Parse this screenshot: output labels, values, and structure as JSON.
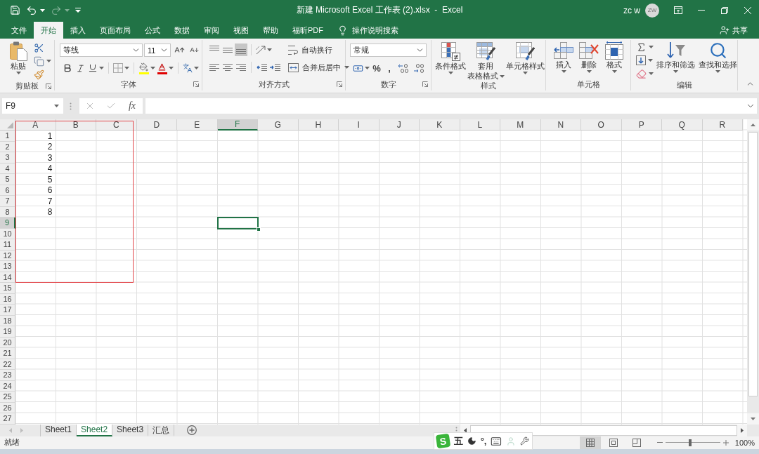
{
  "window": {
    "title": "新建 Microsoft Excel 工作表 (2).xlsx  -  Excel",
    "user": "zc w",
    "avatar_initials": "ZW"
  },
  "quick_access": {
    "save": {
      "disabled": false
    },
    "undo": {
      "disabled": false
    },
    "redo": {
      "disabled": true
    }
  },
  "ribbon_tabs": [
    {
      "label": "文件",
      "selected": false
    },
    {
      "label": "开始",
      "selected": true
    },
    {
      "label": "插入",
      "selected": false
    },
    {
      "label": "页面布局",
      "selected": false
    },
    {
      "label": "公式",
      "selected": false
    },
    {
      "label": "数据",
      "selected": false
    },
    {
      "label": "审阅",
      "selected": false
    },
    {
      "label": "视图",
      "selected": false
    },
    {
      "label": "帮助",
      "selected": false
    },
    {
      "label": "福昕PDF",
      "selected": false
    }
  ],
  "tell_me": {
    "placeholder": "操作说明搜索"
  },
  "share": {
    "label": "共享"
  },
  "ribbon": {
    "clipboard": {
      "label": "剪贴板",
      "paste": "粘贴"
    },
    "font": {
      "label": "字体",
      "font_name": "等线",
      "font_size": "11"
    },
    "alignment": {
      "label": "对齐方式",
      "vertical_align": [
        {
          "selected": false
        },
        {
          "selected": false
        },
        {
          "selected": true
        }
      ],
      "wrap_text": "自动换行",
      "merge_center": "合并后居中"
    },
    "number": {
      "label": "数字",
      "format": "常规",
      "percent": "%",
      "comma": ","
    },
    "styles": {
      "label": "样式",
      "buttons": [
        {
          "lines": [
            "条件格式"
          ]
        },
        {
          "lines": [
            "套用",
            "表格格式"
          ]
        },
        {
          "lines": [
            "单元格样式"
          ]
        }
      ]
    },
    "cells": {
      "label": "单元格",
      "buttons": [
        "插入",
        "删除",
        "格式"
      ]
    },
    "editing": {
      "label": "编辑",
      "buttons": [
        "排序和筛选",
        "查找和选择"
      ]
    }
  },
  "formula_bar": {
    "name_box": "F9",
    "function_label": "fx"
  },
  "sheet": {
    "columns": [
      {
        "label": "A",
        "selected": false
      },
      {
        "label": "B",
        "selected": false
      },
      {
        "label": "C",
        "selected": false
      },
      {
        "label": "D",
        "selected": false
      },
      {
        "label": "E",
        "selected": false
      },
      {
        "label": "F",
        "selected": true
      },
      {
        "label": "G",
        "selected": false
      },
      {
        "label": "H",
        "selected": false
      },
      {
        "label": "I",
        "selected": false
      },
      {
        "label": "J",
        "selected": false
      },
      {
        "label": "K",
        "selected": false
      },
      {
        "label": "L",
        "selected": false
      },
      {
        "label": "M",
        "selected": false
      },
      {
        "label": "N",
        "selected": false
      },
      {
        "label": "O",
        "selected": false
      },
      {
        "label": "P",
        "selected": false
      },
      {
        "label": "Q",
        "selected": false
      },
      {
        "label": "R",
        "selected": false
      }
    ],
    "rows": [
      {
        "label": "1",
        "selected": false,
        "values": [
          "1"
        ]
      },
      {
        "label": "2",
        "selected": false,
        "values": [
          "2"
        ]
      },
      {
        "label": "3",
        "selected": false,
        "values": [
          "3"
        ]
      },
      {
        "label": "4",
        "selected": false,
        "values": [
          "4"
        ]
      },
      {
        "label": "5",
        "selected": false,
        "values": [
          "5"
        ]
      },
      {
        "label": "6",
        "selected": false,
        "values": [
          "6"
        ]
      },
      {
        "label": "7",
        "selected": false,
        "values": [
          "7"
        ]
      },
      {
        "label": "8",
        "selected": false,
        "values": [
          "8"
        ]
      },
      {
        "label": "9",
        "selected": true
      },
      {
        "label": "10",
        "selected": false
      },
      {
        "label": "11",
        "selected": false
      },
      {
        "label": "12",
        "selected": false
      },
      {
        "label": "13",
        "selected": false
      },
      {
        "label": "14",
        "selected": false
      },
      {
        "label": "15",
        "selected": false
      },
      {
        "label": "16",
        "selected": false
      },
      {
        "label": "17",
        "selected": false
      },
      {
        "label": "18",
        "selected": false
      },
      {
        "label": "19",
        "selected": false
      },
      {
        "label": "20",
        "selected": false
      },
      {
        "label": "21",
        "selected": false
      },
      {
        "label": "22",
        "selected": false
      },
      {
        "label": "23",
        "selected": false
      },
      {
        "label": "24",
        "selected": false
      },
      {
        "label": "25",
        "selected": false
      },
      {
        "label": "26",
        "selected": false
      },
      {
        "label": "27",
        "selected": false
      }
    ]
  },
  "sheet_tabs": [
    {
      "label": "Sheet1",
      "selected": false
    },
    {
      "label": "Sheet2",
      "selected": true
    },
    {
      "label": "Sheet3",
      "selected": false
    },
    {
      "label": "汇总",
      "selected": false
    }
  ],
  "status_bar": {
    "status": "就绪",
    "view_buttons": [
      {
        "selected": true
      },
      {
        "selected": false
      },
      {
        "selected": false
      }
    ],
    "zoom": {
      "level": 0.45,
      "reading": "100%"
    }
  },
  "ime_toolbar": {
    "logo": "S",
    "mode": "五",
    "punctuation": "°,"
  }
}
